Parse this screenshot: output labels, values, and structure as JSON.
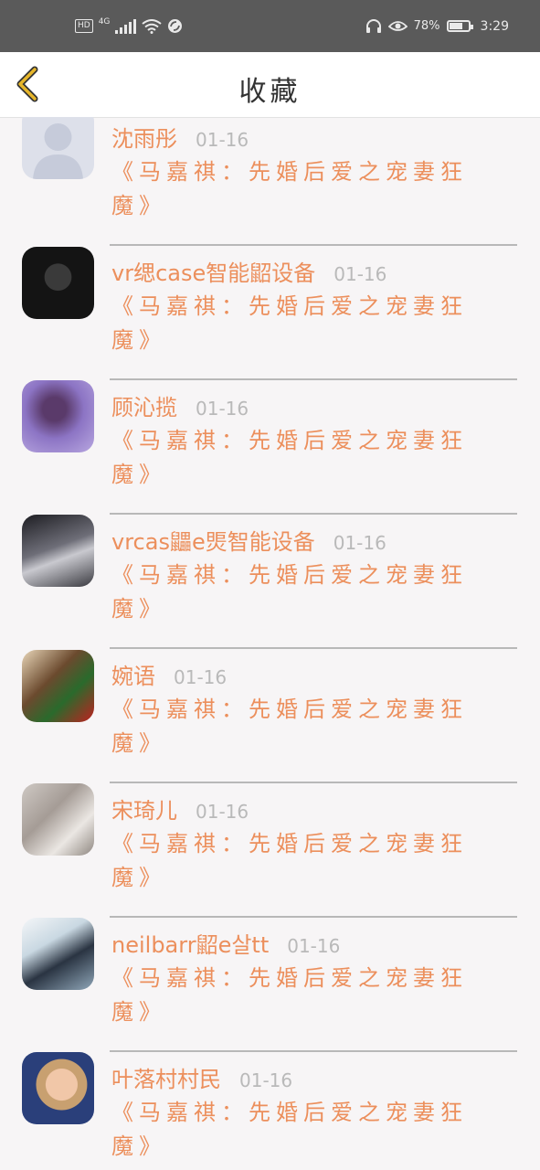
{
  "status_bar": {
    "network_badge": "HD",
    "network_type": "4G",
    "battery_percent": "78%",
    "time": "3:29",
    "icons": [
      "signal-icon",
      "wifi-icon",
      "sync-icon",
      "headphones-icon",
      "eye-icon",
      "battery-icon"
    ],
    "battery_level": 0.78
  },
  "header": {
    "title": "收藏",
    "back_icon": "chevron-left-icon",
    "accent_color": "#e6b62a"
  },
  "colors": {
    "accent_text": "#ec8f5c",
    "date_text": "#b9b9b9",
    "background": "#f7f5f6"
  },
  "items": [
    {
      "name": "沈雨彤",
      "date": "01-16",
      "message": "《马嘉祺：先婚后爱之宠妻狂魔》",
      "avatar": "default-avatar"
    },
    {
      "name": "vr缌case智能鼦设备",
      "date": "01-16",
      "message": "《马嘉祺：先婚后爱之宠妻狂魔》",
      "avatar": "photo-avatar"
    },
    {
      "name": "顾沁揽",
      "date": "01-16",
      "message": "《马嘉祺：先婚后爱之宠妻狂魔》",
      "avatar": "photo-avatar"
    },
    {
      "name": "vrcas鼺e煚智能设备",
      "date": "01-16",
      "message": "《马嘉祺：先婚后爱之宠妻狂魔》",
      "avatar": "photo-avatar"
    },
    {
      "name": "婉语",
      "date": "01-16",
      "message": "《马嘉祺：先婚后爱之宠妻狂魔》",
      "avatar": "photo-avatar"
    },
    {
      "name": "宋琦儿",
      "date": "01-16",
      "message": "《马嘉祺：先婚后爱之宠妻狂魔》",
      "avatar": "photo-avatar"
    },
    {
      "name": "neilbarr鼦e살tt",
      "date": "01-16",
      "message": "《马嘉祺：先婚后爱之宠妻狂魔》",
      "avatar": "photo-avatar"
    },
    {
      "name": "叶落村村民",
      "date": "01-16",
      "message": "《马嘉祺：先婚后爱之宠妻狂魔》",
      "avatar": "photo-avatar"
    }
  ]
}
